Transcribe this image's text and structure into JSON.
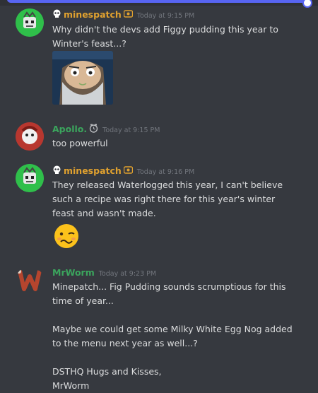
{
  "colors": {
    "background": "#36393f",
    "minespatch": "#e0a12f",
    "apollo": "#3ba55d",
    "mrworm": "#3ba55d",
    "time": "#72767d",
    "text": "#dcddde"
  },
  "messages": [
    {
      "username": "minespatch",
      "prefix_icon": "skull-icon",
      "badge_icon": "nitro-badge-icon",
      "timestamp": "Today at 9:15 PM",
      "text": "Why didn't the devs add Figgy pudding this year to Winter's feast...?",
      "attachment": "wilson-cartoon-image"
    },
    {
      "username": "Apollo.",
      "badge_icon": "clock-badge-icon",
      "timestamp": "Today at 9:15 PM",
      "text": "too powerful"
    },
    {
      "username": "minespatch",
      "prefix_icon": "skull-icon",
      "badge_icon": "nitro-badge-icon",
      "timestamp": "Today at 9:16 PM",
      "text": "They released Waterlogged this year, I can't believe such a recipe was right there for this year's winter feast and wasn't made.",
      "emoji": "woozy-face-emoji"
    },
    {
      "username": "MrWorm",
      "timestamp": "Today at 9:23 PM",
      "text": "Minepatch... Fig Pudding sounds scrumptious for this time of year...\n\nMaybe we could get some Milky White Egg Nog added to the menu next year as well...?\n\nDSTHQ Hugs and Kisses,\nMrWorm"
    }
  ]
}
